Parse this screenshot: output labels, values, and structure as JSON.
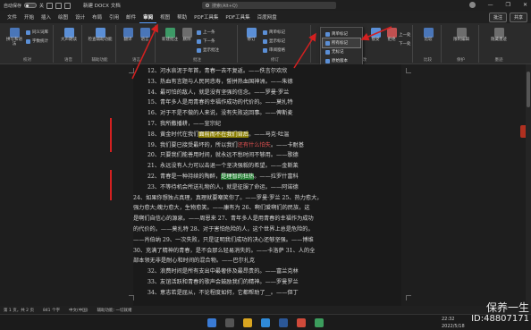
{
  "titlebar": {
    "autosave_label": "自动保存",
    "autosave_state": "关",
    "doc_title": "新建 DOCX 文档",
    "search_placeholder": "搜索(Alt+Q)",
    "window_controls": [
      "minimize-icon",
      "restore-icon",
      "close-icon"
    ]
  },
  "tabs": [
    "文件",
    "开始",
    "插入",
    "绘图",
    "设计",
    "布局",
    "引用",
    "邮件",
    "审阅",
    "视图",
    "帮助",
    "PDF工具集",
    "PDF工具集",
    "百度网盘"
  ],
  "active_tab": "审阅",
  "tab_actions": {
    "comments": "批注",
    "share": "共享"
  },
  "ribbon": {
    "groups": [
      {
        "label": "校对",
        "buttons": [
          "拼写和语法",
          "同义词库",
          "字数统计"
        ]
      },
      {
        "label": "语音",
        "buttons": [
          "大声朗读"
        ]
      },
      {
        "label": "辅助功能",
        "buttons": [
          "检查辅助功能"
        ]
      },
      {
        "label": "语言",
        "buttons": [
          "翻译",
          "语言"
        ]
      },
      {
        "label": "批注",
        "buttons": [
          "新建批注",
          "删除",
          "上一条",
          "下一条",
          "显示批注"
        ]
      },
      {
        "label": "修订",
        "buttons": [
          "修订",
          "简单标记",
          "显示标记",
          "审阅窗格"
        ]
      },
      {
        "label": "更改",
        "buttons": [
          "接受",
          "拒绝",
          "上一处",
          "下一处"
        ]
      },
      {
        "label": "比较",
        "buttons": [
          "比较"
        ]
      },
      {
        "label": "保护",
        "buttons": [
          "限制编辑"
        ]
      },
      {
        "label": "墨迹",
        "buttons": [
          "隐藏墨迹"
        ]
      }
    ],
    "markup_dropdown": [
      "简单标记",
      "所有标记",
      "无标记",
      "原始版本"
    ],
    "dropdown_selected": "所有标记"
  },
  "document": {
    "lines": [
      "12、河水哀泥于年首，青春一去不复返。——佚言尔欢欣",
      "13、热血有言题与人民同悲寿，誓拼热血国神洲。——朱德",
      "14、最可怕的敌人，就是没有坚强的信念。——罗曼·罗兰",
      "15、青年多人是用青春的幸福作成功的代价的。——莫扎特",
      "16、对于不是不做的人来说，没有失败这回事。——俾斯麦",
      "17、我所撒播耕，——宣宗纪",
      "18、黄金时代在我们面前而不在我们背后。——马克·吐温",
      "19、我们要已接受最坏的，所以我们还有什么怕失。——卡耐基",
      "20、只要我们能善用时间，就永远不愁时间不够用。——歌德",
      "21、永远没有人力可以击退一个坚决强毅的希望。——金斯莱",
      "22、青春是一种持续的陶醉，是理智的狂热。——拉罗什富科",
      "23、不等待机会所送礼物的人，就是征服了命运。——阿诺德",
      "24、如果你想独占真理，真理就要嘲笑你了。——罗曼·罗兰 25、热力愈大，",
      "强力愈大;魄力愈大，生物愈笑。——康有为 26、啊们爱啊们的民族，这",
      "是啊们自信心的源泉。——周恩来 27、青年多人是用青春的幸福作为成功",
      "的代价的。——莫扎特 28、对于害怕危险的人，这个世界上总是危险的。",
      "——肖伯纳 29、一次失败，只是证明我们成功的决心还够坚强。——博维",
      "30、充满了精神的青春，是不会那么轻易消失的。——卡洛萨 31、人的全",
      "部本领无非是耐心和时间的混合物。——巴尔扎克",
      "32、浪费时间是所有支出中最奢侈及最昂贵的。——富兰克林",
      "33、友谊活跃和青春的歌声会鼓励我们的精神。——罗曼罗兰",
      "34、意志若是屈从，不论程度如何，它都帮助了__。——但丁"
    ],
    "highlight_yellow": "面前而不在我们背后",
    "highlight_green": "是理智的狂热",
    "red_text": "还有什么怕失"
  },
  "statusbar": {
    "page": "第 1 页，共 2 页",
    "words": "841 个字",
    "language": "中文(中国)",
    "accessibility": "辅助功能: 一切就绪",
    "zoom": "100%"
  },
  "taskbar": {
    "time": "22:32",
    "date": "2022/5/18"
  },
  "watermark": {
    "name": "保养一生",
    "id": "ID:48807171"
  },
  "colors": {
    "accent": "#5aa0ff",
    "arrow": "#d42020",
    "highlight_yellow": "#8a7d00",
    "highlight_green": "#1f7a2e"
  }
}
